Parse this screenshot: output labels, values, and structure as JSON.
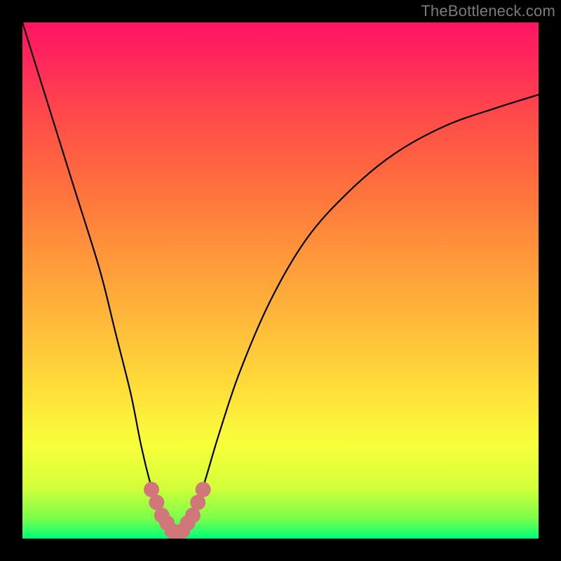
{
  "watermark": "TheBottleneck.com",
  "chart_data": {
    "type": "line",
    "title": "",
    "xlabel": "",
    "ylabel": "",
    "xlim": [
      0,
      100
    ],
    "ylim": [
      0,
      100
    ],
    "series": [
      {
        "name": "bottleneck-curve",
        "x": [
          0,
          5,
          10,
          15,
          18,
          21,
          23,
          25,
          27,
          28.5,
          30,
          31.5,
          33,
          35,
          38,
          42,
          48,
          55,
          63,
          72,
          82,
          92,
          100
        ],
        "values": [
          100,
          84,
          68,
          52,
          40,
          28,
          18,
          10,
          5,
          2,
          1,
          2,
          5,
          10,
          20,
          32,
          46,
          58,
          67,
          74.5,
          80,
          83.5,
          86
        ]
      }
    ],
    "markers": {
      "name": "highlight-region",
      "color": "#d1777a",
      "x": [
        25,
        26,
        27,
        28,
        29,
        30,
        31,
        32,
        33,
        34,
        35
      ],
      "values": [
        9.5,
        7,
        4.5,
        3,
        1.5,
        1,
        1.5,
        3,
        4.5,
        7,
        9.5
      ]
    },
    "background_gradient": {
      "top": "#ff1464",
      "upper_mid": "#ff6b3e",
      "mid": "#ffe13a",
      "lower_mid": "#d4ff3a",
      "bottom": "#00ff7a"
    }
  }
}
